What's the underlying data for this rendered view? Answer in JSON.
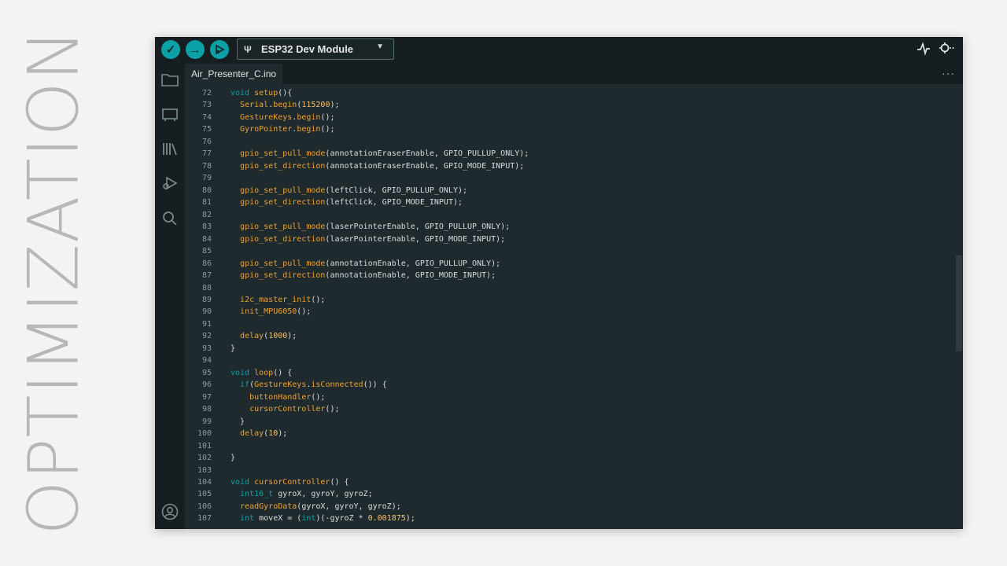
{
  "side_title": "OPTIMIZATION",
  "toolbar": {
    "verify_icon": "check-icon",
    "upload_icon": "arrow-right-icon",
    "debug_icon": "debug-icon",
    "board_name": "ESP32 Dev Module",
    "serial_plotter_icon": "pulse-icon",
    "serial_monitor_icon": "magnifier-dots-icon"
  },
  "tab": {
    "filename": "Air_Presenter_C.ino",
    "more": "···"
  },
  "colors": {
    "accent": "#0ca1a6",
    "editor_bg": "#1f2a2e",
    "function": "#e8a23a",
    "keyword": "#0ca1a6"
  },
  "code": [
    {
      "n": "72",
      "t": [
        [
          "kw",
          "void "
        ],
        [
          "fn",
          "setup"
        ],
        [
          "tx",
          "(){"
        ]
      ]
    },
    {
      "n": "73",
      "t": [
        [
          "tx",
          "  "
        ],
        [
          "fn",
          "Serial"
        ],
        [
          "tx",
          "."
        ],
        [
          "fn",
          "begin"
        ],
        [
          "tx",
          "("
        ],
        [
          "num",
          "115200"
        ],
        [
          "tx",
          ");"
        ]
      ]
    },
    {
      "n": "74",
      "t": [
        [
          "tx",
          "  "
        ],
        [
          "fn",
          "GestureKeys"
        ],
        [
          "tx",
          "."
        ],
        [
          "fn",
          "begin"
        ],
        [
          "tx",
          "();"
        ]
      ]
    },
    {
      "n": "75",
      "t": [
        [
          "tx",
          "  "
        ],
        [
          "fn",
          "GyroPointer"
        ],
        [
          "tx",
          "."
        ],
        [
          "fn",
          "begin"
        ],
        [
          "tx",
          "();"
        ]
      ]
    },
    {
      "n": "76",
      "t": []
    },
    {
      "n": "77",
      "t": [
        [
          "tx",
          "  "
        ],
        [
          "fn",
          "gpio_set_pull_mode"
        ],
        [
          "tx",
          "(annotationEraserEnable, GPIO_PULLUP_ONLY);"
        ]
      ]
    },
    {
      "n": "78",
      "t": [
        [
          "tx",
          "  "
        ],
        [
          "fn",
          "gpio_set_direction"
        ],
        [
          "tx",
          "(annotationEraserEnable, GPIO_MODE_INPUT);"
        ]
      ]
    },
    {
      "n": "79",
      "t": []
    },
    {
      "n": "80",
      "t": [
        [
          "tx",
          "  "
        ],
        [
          "fn",
          "gpio_set_pull_mode"
        ],
        [
          "tx",
          "(leftClick, GPIO_PULLUP_ONLY);"
        ]
      ]
    },
    {
      "n": "81",
      "t": [
        [
          "tx",
          "  "
        ],
        [
          "fn",
          "gpio_set_direction"
        ],
        [
          "tx",
          "(leftClick, GPIO_MODE_INPUT);"
        ]
      ]
    },
    {
      "n": "82",
      "t": []
    },
    {
      "n": "83",
      "t": [
        [
          "tx",
          "  "
        ],
        [
          "fn",
          "gpio_set_pull_mode"
        ],
        [
          "tx",
          "(laserPointerEnable, GPIO_PULLUP_ONLY);"
        ]
      ]
    },
    {
      "n": "84",
      "t": [
        [
          "tx",
          "  "
        ],
        [
          "fn",
          "gpio_set_direction"
        ],
        [
          "tx",
          "(laserPointerEnable, GPIO_MODE_INPUT);"
        ]
      ]
    },
    {
      "n": "85",
      "t": []
    },
    {
      "n": "86",
      "t": [
        [
          "tx",
          "  "
        ],
        [
          "fn",
          "gpio_set_pull_mode"
        ],
        [
          "tx",
          "(annotationEnable, GPIO_PULLUP_ONLY);"
        ]
      ]
    },
    {
      "n": "87",
      "t": [
        [
          "tx",
          "  "
        ],
        [
          "fn",
          "gpio_set_direction"
        ],
        [
          "tx",
          "(annotationEnable, GPIO_MODE_INPUT);"
        ]
      ]
    },
    {
      "n": "88",
      "t": []
    },
    {
      "n": "89",
      "t": [
        [
          "tx",
          "  "
        ],
        [
          "fn",
          "i2c_master_init"
        ],
        [
          "tx",
          "();"
        ]
      ]
    },
    {
      "n": "90",
      "t": [
        [
          "tx",
          "  "
        ],
        [
          "fn",
          "init_MPU6050"
        ],
        [
          "tx",
          "();"
        ]
      ]
    },
    {
      "n": "91",
      "t": []
    },
    {
      "n": "92",
      "t": [
        [
          "tx",
          "  "
        ],
        [
          "fn",
          "delay"
        ],
        [
          "tx",
          "("
        ],
        [
          "num",
          "1000"
        ],
        [
          "tx",
          ");"
        ]
      ]
    },
    {
      "n": "93",
      "t": [
        [
          "tx",
          "}"
        ]
      ]
    },
    {
      "n": "94",
      "t": []
    },
    {
      "n": "95",
      "t": [
        [
          "kw",
          "void "
        ],
        [
          "fn",
          "loop"
        ],
        [
          "tx",
          "() {"
        ]
      ]
    },
    {
      "n": "96",
      "t": [
        [
          "tx",
          "  "
        ],
        [
          "kw",
          "if"
        ],
        [
          "tx",
          "("
        ],
        [
          "fn",
          "GestureKeys"
        ],
        [
          "tx",
          "."
        ],
        [
          "fn",
          "isConnected"
        ],
        [
          "tx",
          "()) {"
        ]
      ]
    },
    {
      "n": "97",
      "t": [
        [
          "tx",
          "    "
        ],
        [
          "fn",
          "buttonHandler"
        ],
        [
          "tx",
          "();"
        ]
      ]
    },
    {
      "n": "98",
      "t": [
        [
          "tx",
          "    "
        ],
        [
          "fn",
          "cursorController"
        ],
        [
          "tx",
          "();"
        ]
      ]
    },
    {
      "n": "99",
      "t": [
        [
          "tx",
          "  }"
        ]
      ]
    },
    {
      "n": "100",
      "t": [
        [
          "tx",
          "  "
        ],
        [
          "fn",
          "delay"
        ],
        [
          "tx",
          "("
        ],
        [
          "num",
          "10"
        ],
        [
          "tx",
          ");"
        ]
      ]
    },
    {
      "n": "101",
      "t": []
    },
    {
      "n": "102",
      "t": [
        [
          "tx",
          "}"
        ]
      ]
    },
    {
      "n": "103",
      "t": []
    },
    {
      "n": "104",
      "t": [
        [
          "kw",
          "void "
        ],
        [
          "fn",
          "cursorController"
        ],
        [
          "tx",
          "() {"
        ]
      ]
    },
    {
      "n": "105",
      "t": [
        [
          "tx",
          "  "
        ],
        [
          "kw",
          "int16_t"
        ],
        [
          "tx",
          " gyroX, gyroY, gyroZ;"
        ]
      ]
    },
    {
      "n": "106",
      "t": [
        [
          "tx",
          "  "
        ],
        [
          "fn",
          "readGyroData"
        ],
        [
          "tx",
          "(gyroX, gyroY, gyroZ);"
        ]
      ]
    },
    {
      "n": "107",
      "t": [
        [
          "tx",
          "  "
        ],
        [
          "kw",
          "int"
        ],
        [
          "tx",
          " moveX = ("
        ],
        [
          "kw",
          "int"
        ],
        [
          "tx",
          ")(-gyroZ * "
        ],
        [
          "num",
          "0.001875"
        ],
        [
          "tx",
          ");"
        ]
      ]
    }
  ]
}
